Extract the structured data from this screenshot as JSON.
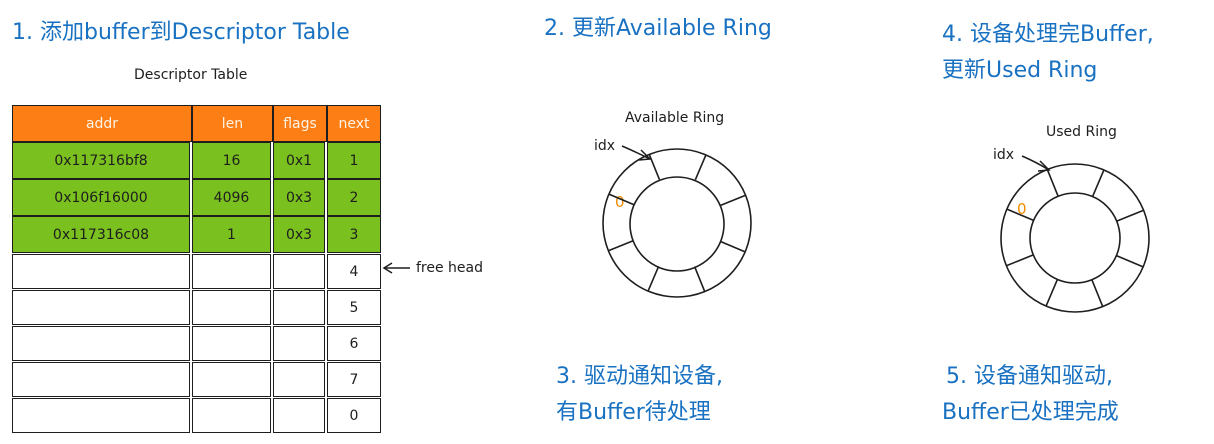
{
  "steps": {
    "s1": "1. 添加buffer到Descriptor Table",
    "s2": "2. 更新Available Ring",
    "s3_line1": "3. 驱动通知设备,",
    "s3_line2": "有Buffer待处理",
    "s4_line1": "4. 设备处理完Buffer,",
    "s4_line2": "更新Used Ring",
    "s5_line1": "5. 设备通知驱动,",
    "s5_line2": "Buffer已处理完成"
  },
  "descriptor_table": {
    "title": "Descriptor Table",
    "headers": [
      "addr",
      "len",
      "flags",
      "next"
    ],
    "rows": [
      {
        "addr": "0x117316bf8",
        "len": "16",
        "flags": "0x1",
        "next": "1"
      },
      {
        "addr": "0x106f16000",
        "len": "4096",
        "flags": "0x3",
        "next": "2"
      },
      {
        "addr": "0x117316c08",
        "len": "1",
        "flags": "0x3",
        "next": "3"
      },
      {
        "addr": "",
        "len": "",
        "flags": "",
        "next": "4"
      },
      {
        "addr": "",
        "len": "",
        "flags": "",
        "next": "5"
      },
      {
        "addr": "",
        "len": "",
        "flags": "",
        "next": "6"
      },
      {
        "addr": "",
        "len": "",
        "flags": "",
        "next": "7"
      },
      {
        "addr": "",
        "len": "",
        "flags": "",
        "next": "0"
      }
    ],
    "free_head_label": "free head",
    "colors": {
      "header": "#fd7e14",
      "used": "#7ac01e",
      "empty": "#ffffff"
    }
  },
  "available_ring": {
    "title": "Available Ring",
    "idx_label": "idx",
    "slot_value": "0"
  },
  "used_ring": {
    "title": "Used Ring",
    "idx_label": "idx",
    "slot_value": "0"
  }
}
